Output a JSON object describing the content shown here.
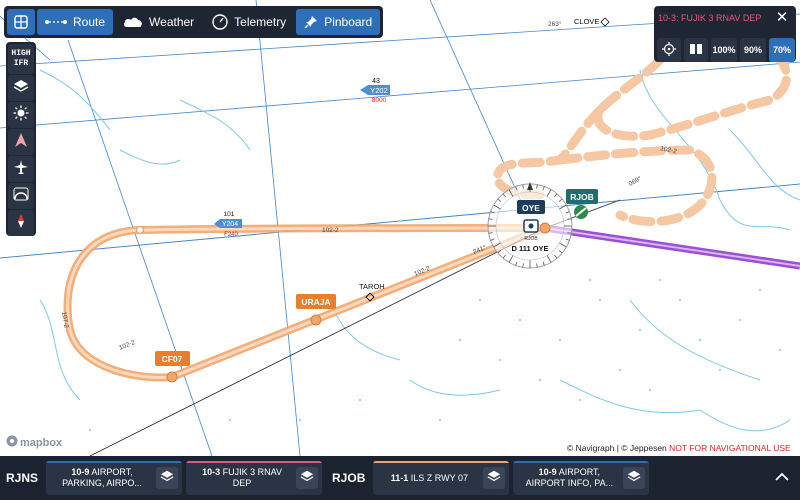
{
  "toolbar": {
    "route_label": "Route",
    "weather_label": "Weather",
    "telemetry_label": "Telemetry",
    "pinboard_label": "Pinboard"
  },
  "sidebar": {
    "high_ifr_line1": "HIGH",
    "high_ifr_line2": "IFR"
  },
  "pinboard_panel": {
    "chart_code": "10-3:",
    "chart_name": "FUJIK 3 RNAV DEP",
    "zoom_options": [
      "100%",
      "90%",
      "70%"
    ],
    "selected_zoom": "70%"
  },
  "map": {
    "waypoints": {
      "clove": "CLOVE",
      "taroh": "TAROH",
      "uraja": "URAJA",
      "cf07": "CF07",
      "rjob": "RJOB",
      "oye": "OYE"
    },
    "vor_info": "D 111 OYE",
    "vor_rjob_small": "RJOB",
    "airways": {
      "y202_label": "Y202",
      "y202_top": "43",
      "y202_alt": "8000",
      "y204_label": "Y204",
      "y204_top": "101",
      "y204_fl": "F240"
    },
    "course_labels": {
      "c263": "263°",
      "c102": "102-2",
      "c102b": "102-2",
      "c102c": "102-2",
      "c107": "107-2",
      "c102d": "102-2",
      "c0697": "069°",
      "c2418": "241°"
    }
  },
  "attribution": {
    "navigraph": "© Navigraph | © Jeppesen",
    "warning": "NOT FOR NAVIGATIONAL USE",
    "mapbox": "mapbox"
  },
  "bottombar": {
    "airport1": "RJNS",
    "airport2": "RJOB",
    "tabs": [
      {
        "code": "10-9",
        "name": "AIRPORT, PARKING, AIRPO...",
        "accent": "#2e6fb8"
      },
      {
        "code": "10-3",
        "name": "FUJIK 3 RNAV DEP",
        "accent": "#e8557a"
      },
      {
        "code": "11-1",
        "name": "ILS Z RWY 07",
        "accent": "#f2a56a"
      },
      {
        "code": "10-9",
        "name": "AIRPORT, AIRPORT INFO, PA...",
        "accent": "#2e6fb8"
      }
    ]
  },
  "colors": {
    "panel_bg": "#1e2633",
    "accent_blue": "#2e6fb8",
    "route_orange": "#f2a56a",
    "departure_purple": "#9b4fd6",
    "water_cyan": "#7ec8e3"
  }
}
